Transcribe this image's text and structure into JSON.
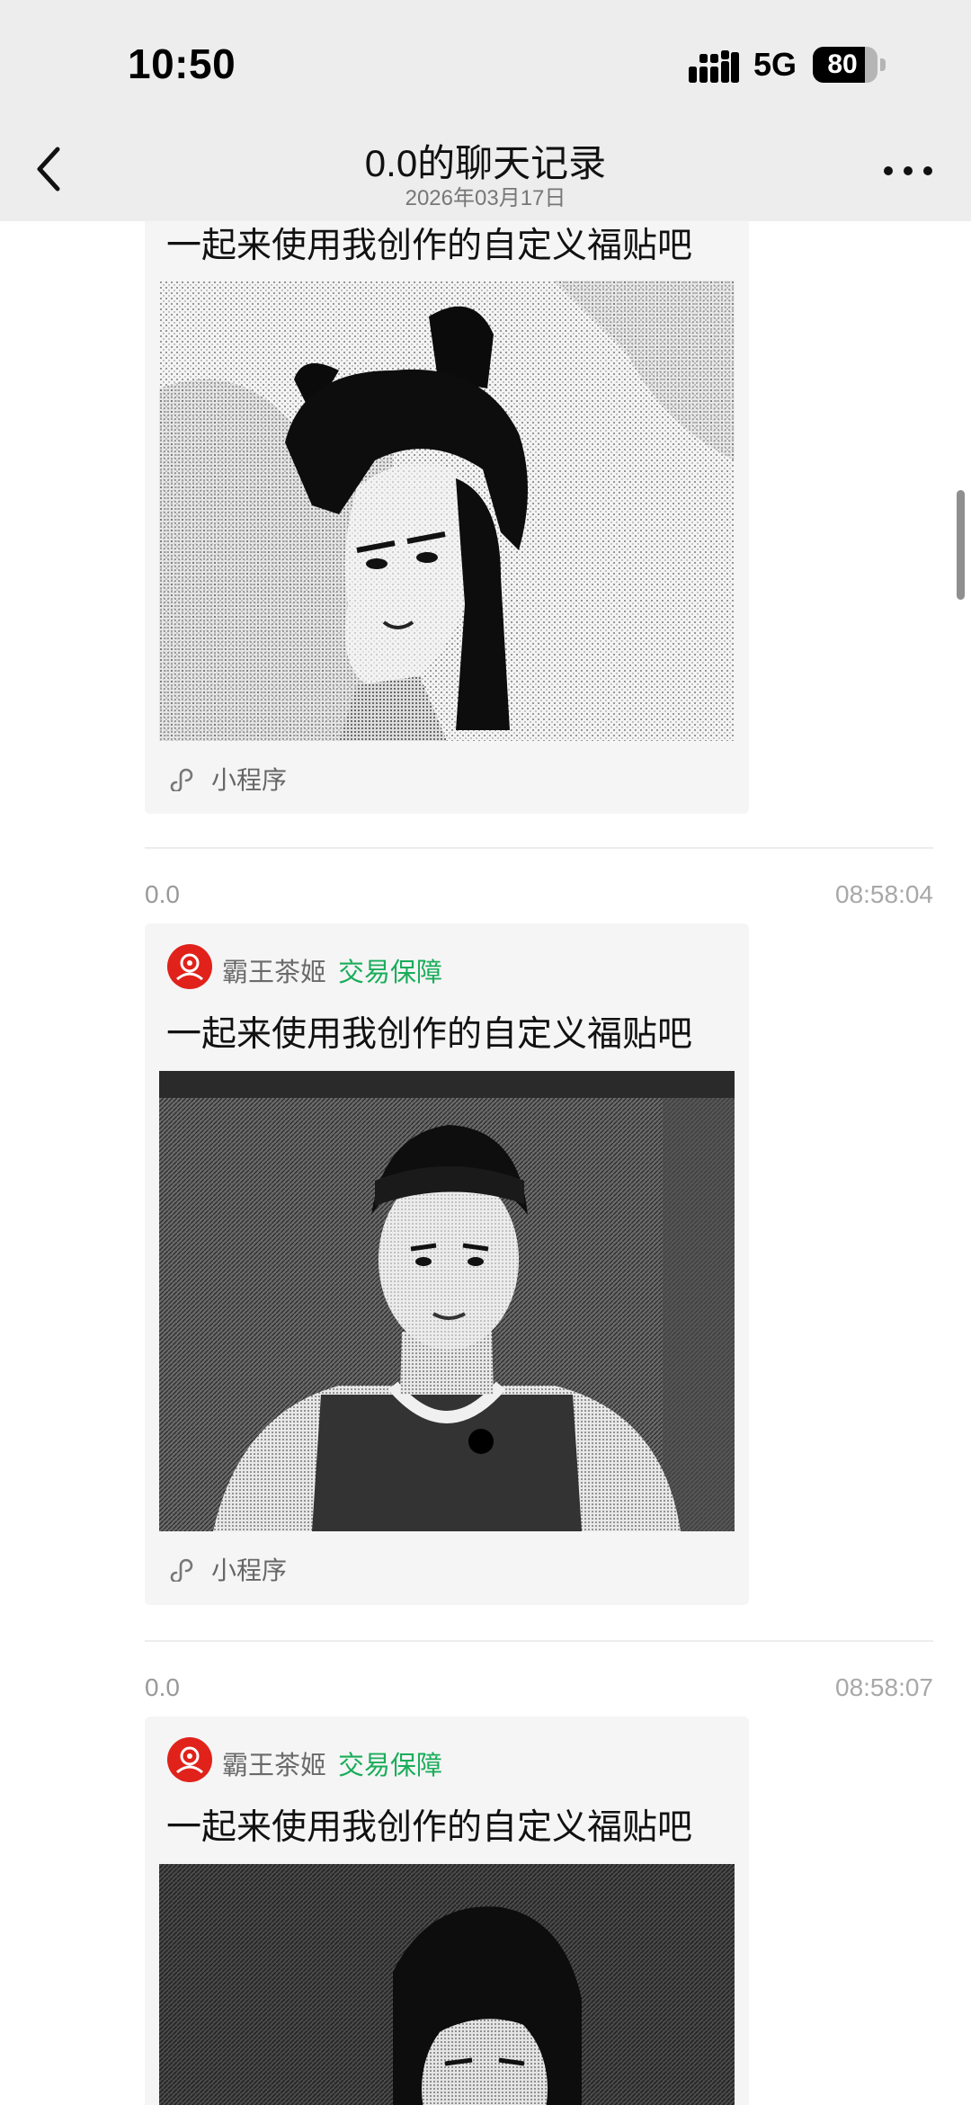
{
  "status_bar": {
    "time": "10:50",
    "network": "5G",
    "battery": "80",
    "battery_level": 0.8
  },
  "header": {
    "title": "0.0的聊天记录",
    "subtitle": "2026年03月17日",
    "back_icon": "chevron-left-icon",
    "more_icon": "ellipsis-icon"
  },
  "messages": [
    {
      "card_title": "一起来使用我创作的自定义福贴吧",
      "mini_program_label": "小程序"
    },
    {
      "sender": "0.0",
      "time": "08:58:04",
      "brand_name": "霸王茶姬",
      "badge": "交易保障",
      "card_title": "一起来使用我创作的自定义福贴吧",
      "mini_program_label": "小程序"
    },
    {
      "sender": "0.0",
      "time": "08:58:07",
      "brand_name": "霸王茶姬",
      "badge": "交易保障",
      "card_title": "一起来使用我创作的自定义福贴吧"
    }
  ],
  "colors": {
    "header_bg": "#ededed",
    "card_bg": "#f5f5f5",
    "badge_green": "#1aad5a",
    "brand_red": "#e0221b"
  }
}
